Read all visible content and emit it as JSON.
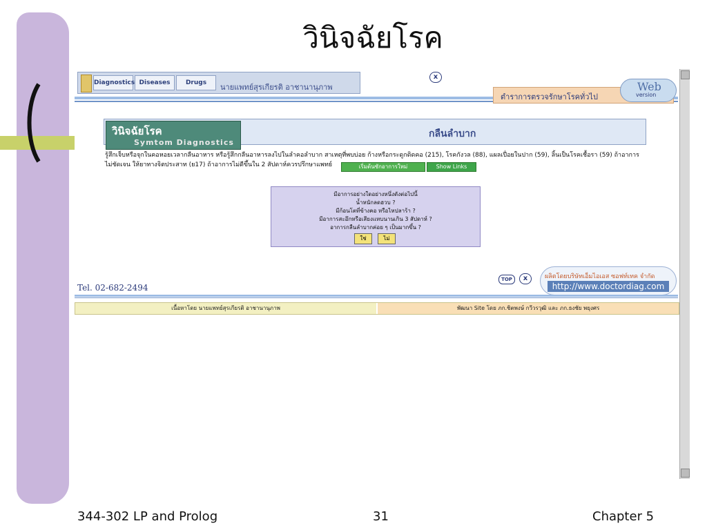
{
  "slide": {
    "title": "วินิจฉัยโรค",
    "footer_left": "344-302 LP and Prolog",
    "footer_center": "31",
    "footer_right": "Chapter 5"
  },
  "web": {
    "nav": {
      "diagnostics": "Diagnostics",
      "diseases": "Diseases",
      "drugs": "Drugs",
      "doctor": "นายแพทย์สุรเกียรติ อาชานานุภาพ"
    },
    "close_icon": "x",
    "banner_right": "ตำราการตรวจรักษาโรคทั่วไป",
    "web_badge": {
      "web": "Web",
      "version": "version"
    },
    "panel": {
      "logo_thai": "วินิจฉัยโรค",
      "logo_en": "Symtom Diagnostics",
      "heading": "กลืนลำบาก",
      "text_line1": "รู้สึกเจ็บหรือจุกในคอหอยเวลากลืนอาหาร หรือรู้สึกกลืนอาหารลงไปในลำคอลำบาก สาเหตุที่พบบ่อย ก้างหรือกระดูกติดคอ (215), โรคกังวล (88), แผลเปื่อยในปาก (59), ลิ้นเป็นโรคเชื้อรา (59) ถ้าอาการ",
      "text_line2": "ไม่ชัดเจน ให้ยาทางจิตประสาท (ย17) ถ้าอาการไม่ดีขึ้นใน 2 สัปดาห์ควรปรึกษาแพทย์",
      "start_button": "เริ่มต้นซักอาการใหม่",
      "show_links": "Show Links"
    },
    "question": {
      "lines": [
        "มีอาการอย่างใดอย่างหนึ่งดังต่อไปนี้",
        "น้ำหนักลดฮวบ ?",
        "มีก้อนโตที่ข้างคอ หรือไหปลาร้า ?",
        "มีอาการสะอึกหรือเสียงแหบนานเกิน 3 สัปดาห์ ?",
        "อาการกลืนลำบากค่อย ๆ เป็นมากขึ้น ?"
      ],
      "yes": "ใช่",
      "no": "ไม่"
    },
    "tel": "Tel. 02-682-2494",
    "top_button": "TOP",
    "brand": {
      "company": "ผลิตโดยบริษัทเอ็มไอเอส ซอฟท์เทค จำกัด",
      "url": "http://www.doctordiag.com"
    },
    "credits": {
      "left": "เนื้อหาโดย นายแพทย์สุรเกียรติ อาชานานุภาพ",
      "right": "พัฒนา Site โดย ภก.ชิตพงษ์ กวีวรวุฒิ และ ภก.ธงชัย พยุงศร"
    }
  }
}
